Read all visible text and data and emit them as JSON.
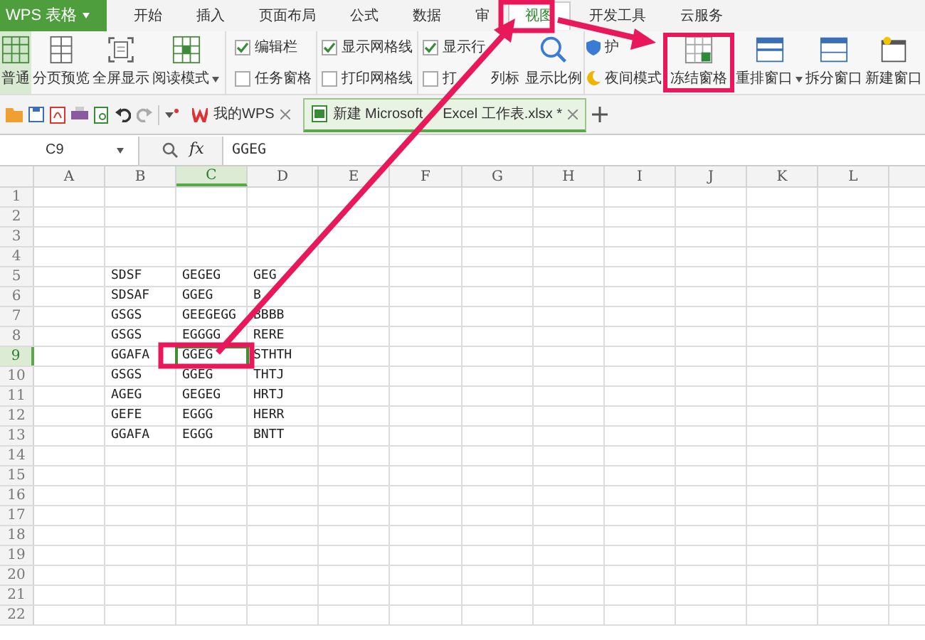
{
  "app_menu": {
    "label": "WPS 表格"
  },
  "menu_tabs": [
    {
      "label": "开始",
      "selected": false
    },
    {
      "label": "插入",
      "selected": false
    },
    {
      "label": "页面布局",
      "selected": false
    },
    {
      "label": "公式",
      "selected": false
    },
    {
      "label": "数据",
      "selected": false
    },
    {
      "label": "审",
      "selected": false
    },
    {
      "label": "视图",
      "selected": true
    },
    {
      "label": "开发工具",
      "selected": false
    },
    {
      "label": "云服务",
      "selected": false
    }
  ],
  "ribbon": {
    "view_buttons": [
      {
        "label": "普通",
        "selected": true,
        "dropdown": false
      },
      {
        "label": "分页预览",
        "selected": false,
        "dropdown": false
      },
      {
        "label": "全屏显示",
        "selected": false,
        "dropdown": false
      },
      {
        "label": "阅读模式",
        "selected": false,
        "dropdown": true
      }
    ],
    "checkboxes": [
      {
        "parts": [
          "编辑栏"
        ],
        "checked": true
      },
      {
        "parts": [
          "任务窗格"
        ],
        "checked": false
      },
      {
        "parts": [
          "显示网格线"
        ],
        "checked": true
      },
      {
        "parts": [
          "打印网格线"
        ],
        "checked": false
      },
      {
        "parts": [
          "显示行"
        ],
        "checked": true
      },
      {
        "parts": [
          "打",
          "列标"
        ],
        "checked": false
      }
    ],
    "zoom_button": {
      "label": "显示比例"
    },
    "modes": [
      {
        "label": "护"
      },
      {
        "label": "夜间模式"
      }
    ],
    "window_buttons": [
      {
        "label": "冻结窗格",
        "dropdown": false
      },
      {
        "label": "重排窗口",
        "dropdown": true
      },
      {
        "label": "拆分窗口",
        "dropdown": false
      },
      {
        "label": "新建窗口",
        "dropdown": false
      }
    ]
  },
  "doc_tabs": [
    {
      "parts": [
        "我的WPS"
      ],
      "selected": false
    },
    {
      "parts": [
        "新建 Microsoft",
        "Excel 工作表.xlsx *"
      ],
      "selected": true
    }
  ],
  "formula_bar": {
    "name_box": "C9",
    "fx": "fx",
    "value": "GGEG"
  },
  "sheet": {
    "columns": [
      {
        "label": "A",
        "selected": false
      },
      {
        "label": "B",
        "selected": false
      },
      {
        "label": "C",
        "selected": true
      },
      {
        "label": "D",
        "selected": false
      },
      {
        "label": "E",
        "selected": false
      },
      {
        "label": "F",
        "selected": false
      },
      {
        "label": "G",
        "selected": false
      },
      {
        "label": "H",
        "selected": false
      },
      {
        "label": "I",
        "selected": false
      },
      {
        "label": "J",
        "selected": false
      },
      {
        "label": "K",
        "selected": false
      },
      {
        "label": "L",
        "selected": false
      }
    ],
    "rows": [
      {
        "label": "1",
        "selected": false
      },
      {
        "label": "2",
        "selected": false
      },
      {
        "label": "3",
        "selected": false
      },
      {
        "label": "4",
        "selected": false
      },
      {
        "label": "5",
        "selected": false,
        "cells": [
          {
            "text": "SDSF",
            "active": false
          },
          {
            "text": "GEGEG",
            "active": false
          },
          {
            "text": "GEG",
            "active": false
          }
        ]
      },
      {
        "label": "6",
        "selected": false,
        "cells": [
          {
            "text": "SDSAF",
            "active": false
          },
          {
            "text": "GGEG",
            "active": false
          },
          {
            "text": "B",
            "active": false
          }
        ]
      },
      {
        "label": "7",
        "selected": false,
        "cells": [
          {
            "text": "GSGS",
            "active": false
          },
          {
            "text": "GEEGEGG",
            "active": false
          },
          {
            "text": "BBBB",
            "active": false
          }
        ]
      },
      {
        "label": "8",
        "selected": false,
        "cells": [
          {
            "text": "GSGS",
            "active": false
          },
          {
            "text": "EGGGG",
            "active": false
          },
          {
            "text": "RERE",
            "active": false
          }
        ]
      },
      {
        "label": "9",
        "selected": true,
        "cells": [
          {
            "text": "GGAFA",
            "active": false
          },
          {
            "text": "GGEG",
            "active": true
          },
          {
            "text": "STHTH",
            "active": false
          }
        ]
      },
      {
        "label": "10",
        "selected": false,
        "cells": [
          {
            "text": "GSGS",
            "active": false
          },
          {
            "text": "GGEG",
            "active": false
          },
          {
            "text": "THTJ",
            "active": false
          }
        ]
      },
      {
        "label": "11",
        "selected": false,
        "cells": [
          {
            "text": "AGEG",
            "active": false
          },
          {
            "text": "GEGEG",
            "active": false
          },
          {
            "text": "HRTJ",
            "active": false
          }
        ]
      },
      {
        "label": "12",
        "selected": false,
        "cells": [
          {
            "text": "GEFE",
            "active": false
          },
          {
            "text": "EGGG",
            "active": false
          },
          {
            "text": "HERR",
            "active": false
          }
        ]
      },
      {
        "label": "13",
        "selected": false,
        "cells": [
          {
            "text": "GGAFA",
            "active": false
          },
          {
            "text": "EGGG",
            "active": false
          },
          {
            "text": "BNTT",
            "active": false
          }
        ]
      },
      {
        "label": "14",
        "selected": false
      },
      {
        "label": "15",
        "selected": false
      },
      {
        "label": "16",
        "selected": false
      },
      {
        "label": "17",
        "selected": false
      },
      {
        "label": "18",
        "selected": false
      },
      {
        "label": "19",
        "selected": false
      },
      {
        "label": "20",
        "selected": false
      },
      {
        "label": "21",
        "selected": false
      },
      {
        "label": "22",
        "selected": false
      }
    ]
  }
}
